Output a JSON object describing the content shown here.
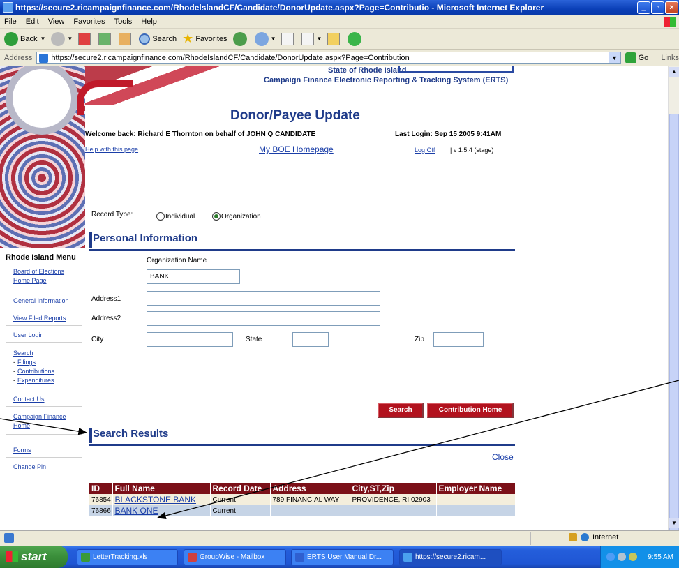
{
  "window": {
    "title": "https://secure2.ricampaignfinance.com/RhodelslandCF/Candidate/DonorUpdate.aspx?Page=Contributio - Microsoft Internet Explorer"
  },
  "menubar": [
    "File",
    "Edit",
    "View",
    "Favorites",
    "Tools",
    "Help"
  ],
  "toolbar": {
    "back": "Back",
    "search": "Search",
    "favorites": "Favorites"
  },
  "address": {
    "label": "Address",
    "url": "https://secure2.ricampaignfinance.com/RhodeIslandCF/Candidate/DonorUpdate.aspx?Page=Contribution",
    "go": "Go",
    "links": "Links"
  },
  "header": {
    "state": "State of Rhode Island",
    "erts": "Campaign Finance Electronic Reporting & Tracking System (ERTS)",
    "page_title": "Donor/Payee Update",
    "welcome": "Welcome back: Richard E Thornton on behalf of JOHN Q CANDIDATE",
    "last_login": "Last Login: Sep 15 2005 9:41AM",
    "help": "Help with this page",
    "my_boe": "My BOE Homepage",
    "log_off": "Log Off",
    "version": "| v 1.5.4 (stage)"
  },
  "left_menu": {
    "heading": "Rhode Island Menu",
    "board": [
      "Board of Elections",
      "Home Page"
    ],
    "general": "General Information",
    "view_filed": "View Filed Reports",
    "user_login": "User Login",
    "search": "Search",
    "filings": "Filings",
    "contributions": "Contributions",
    "expenditures": "Expenditures",
    "contact": "Contact Us",
    "campaign": [
      "Campaign Finance",
      "Home"
    ],
    "forms": "Forms",
    "change_pin": "Change Pin"
  },
  "form": {
    "record_type_label": "Record Type:",
    "record_type_options": [
      "Individual",
      "Organization"
    ],
    "record_type_selected": "Organization",
    "personal_info_heading": "Personal Information",
    "org_name_label": "Organization Name",
    "org_name_value": "BANK",
    "address1_label": "Address1",
    "address2_label": "Address2",
    "city_label": "City",
    "state_label": "State",
    "zip_label": "Zip",
    "search_button": "Search",
    "contribution_home_button": "Contribution Home"
  },
  "results": {
    "heading": "Search Results",
    "close": "Close",
    "columns": [
      "ID",
      "Full Name",
      "Record Date",
      "Address",
      "City,ST,Zip",
      "Employer Name"
    ],
    "rows": [
      {
        "id": "76854",
        "name": "BLACKSTONE BANK",
        "date": "Current",
        "address": "789 FINANCIAL WAY",
        "city": "PROVIDENCE, RI 02903",
        "employer": ""
      },
      {
        "id": "76866",
        "name": "BANK ONE",
        "date": "Current",
        "address": "",
        "city": "",
        "employer": ""
      }
    ]
  },
  "statusbar": {
    "zone": "Internet"
  },
  "taskbar": {
    "start": "start",
    "tasks": [
      "LetterTracking.xls",
      "GroupWise - Mailbox",
      "ERTS User Manual Dr...",
      "https://secure2.ricam..."
    ],
    "clock": "9:55 AM"
  },
  "colors": {
    "accent_blue": "#1f3b8a",
    "button_red": "#b2121e",
    "header_maroon": "#7b1018"
  }
}
